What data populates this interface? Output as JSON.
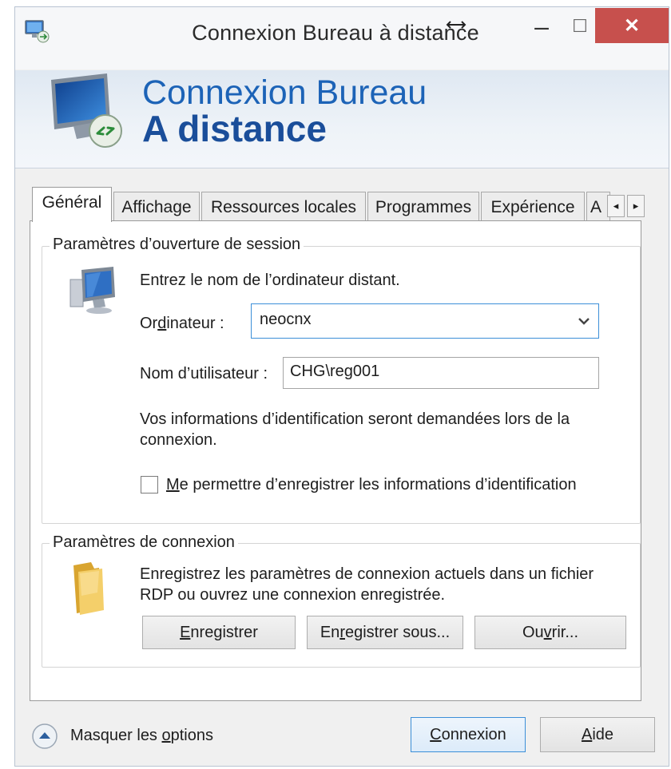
{
  "window": {
    "title": "Connexion Bureau à distance",
    "minimize_glyph": "–",
    "maximize_glyph": "☐",
    "close_glyph": "✕"
  },
  "banner": {
    "line1": "Connexion Bureau",
    "line2": "A distance"
  },
  "tabs": [
    {
      "label": "Général",
      "active": true
    },
    {
      "label": "Affichage",
      "active": false
    },
    {
      "label": "Ressources locales",
      "active": false
    },
    {
      "label": "Programmes",
      "active": false
    },
    {
      "label": "Expérience",
      "active": false
    },
    {
      "label": "A",
      "active": false
    }
  ],
  "tab_scroll": {
    "left": "◂",
    "right": "▸"
  },
  "logon": {
    "group_label": "Paramètres d’ouverture de session",
    "instruction": "Entrez le nom de l’ordinateur distant.",
    "computer_label_pre": "Or",
    "computer_label_access": "d",
    "computer_label_post": "inateur :",
    "computer_value": "neocnx",
    "username_label": "Nom d’utilisateur :",
    "username_value": "CHG\\reg001",
    "credentials_note": "Vos informations d’identification seront demandées lors de la connexion.",
    "save_checkbox_access": "M",
    "save_checkbox_rest": "e permettre d’enregistrer les informations d’identification",
    "save_checked": false
  },
  "connection": {
    "group_label": "Paramètres de connexion",
    "description": "Enregistrez les paramètres de connexion actuels dans un fichier RDP ou ouvrez une connexion enregistrée.",
    "save_access": "E",
    "save_rest": "nregistrer",
    "saveas_pre": "En",
    "saveas_access": "r",
    "saveas_post": "egistrer sous...",
    "open_pre": "Ou",
    "open_access": "v",
    "open_post": "rir..."
  },
  "footer": {
    "hide_options_pre": "Masquer les ",
    "hide_options_access": "o",
    "hide_options_post": "ptions",
    "connect_access": "C",
    "connect_rest": "onnexion",
    "help_access": "A",
    "help_rest": "ide"
  },
  "colors": {
    "accent_blue": "#1c63b7",
    "close_red": "#c7504d",
    "focus_border": "#3c8fd8"
  },
  "icons": {
    "app": "rdp-monitor-icon",
    "banner": "rdp-monitor-large-icon",
    "computer": "computer-icon",
    "folder": "folder-icon",
    "options": "chevron-up-circle-icon",
    "dropdown": "chevron-down-icon"
  }
}
